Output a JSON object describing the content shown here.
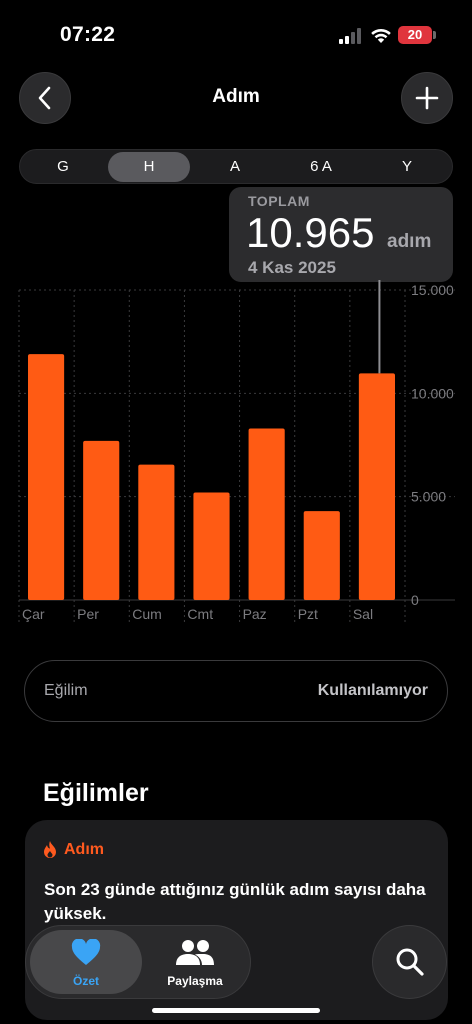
{
  "status": {
    "time": "07:22",
    "battery": "20"
  },
  "nav": {
    "title": "Adım"
  },
  "segments": [
    "G",
    "H",
    "A",
    "6 A",
    "Y"
  ],
  "selected_segment": "H",
  "tooltip": {
    "label": "TOPLAM",
    "value": "10.965",
    "unit": "adım",
    "date": "4 Kas 2025"
  },
  "chart_data": {
    "type": "bar",
    "categories": [
      "Çar",
      "Per",
      "Cum",
      "Cmt",
      "Paz",
      "Pzt",
      "Sal"
    ],
    "values": [
      11900,
      7700,
      6550,
      5200,
      8300,
      4300,
      10965
    ],
    "y_ticks": [
      "15.000",
      "10.000",
      "5.000",
      "0"
    ],
    "ylim": [
      0,
      15000
    ],
    "selected_index": 6,
    "bar_color": "#ff5b14"
  },
  "trend": {
    "label": "Eğilim",
    "value": "Kullanılamıyor"
  },
  "section_title": "Eğilimler",
  "trend_card": {
    "label": "Adım",
    "text": "Son 23 günde attığınız günlük adım sayısı daha yüksek."
  },
  "tabs": {
    "summary": "Özet",
    "sharing": "Paylaşma"
  },
  "colors": {
    "accent": "#ff5b14",
    "heart": "#3aa4f5"
  }
}
